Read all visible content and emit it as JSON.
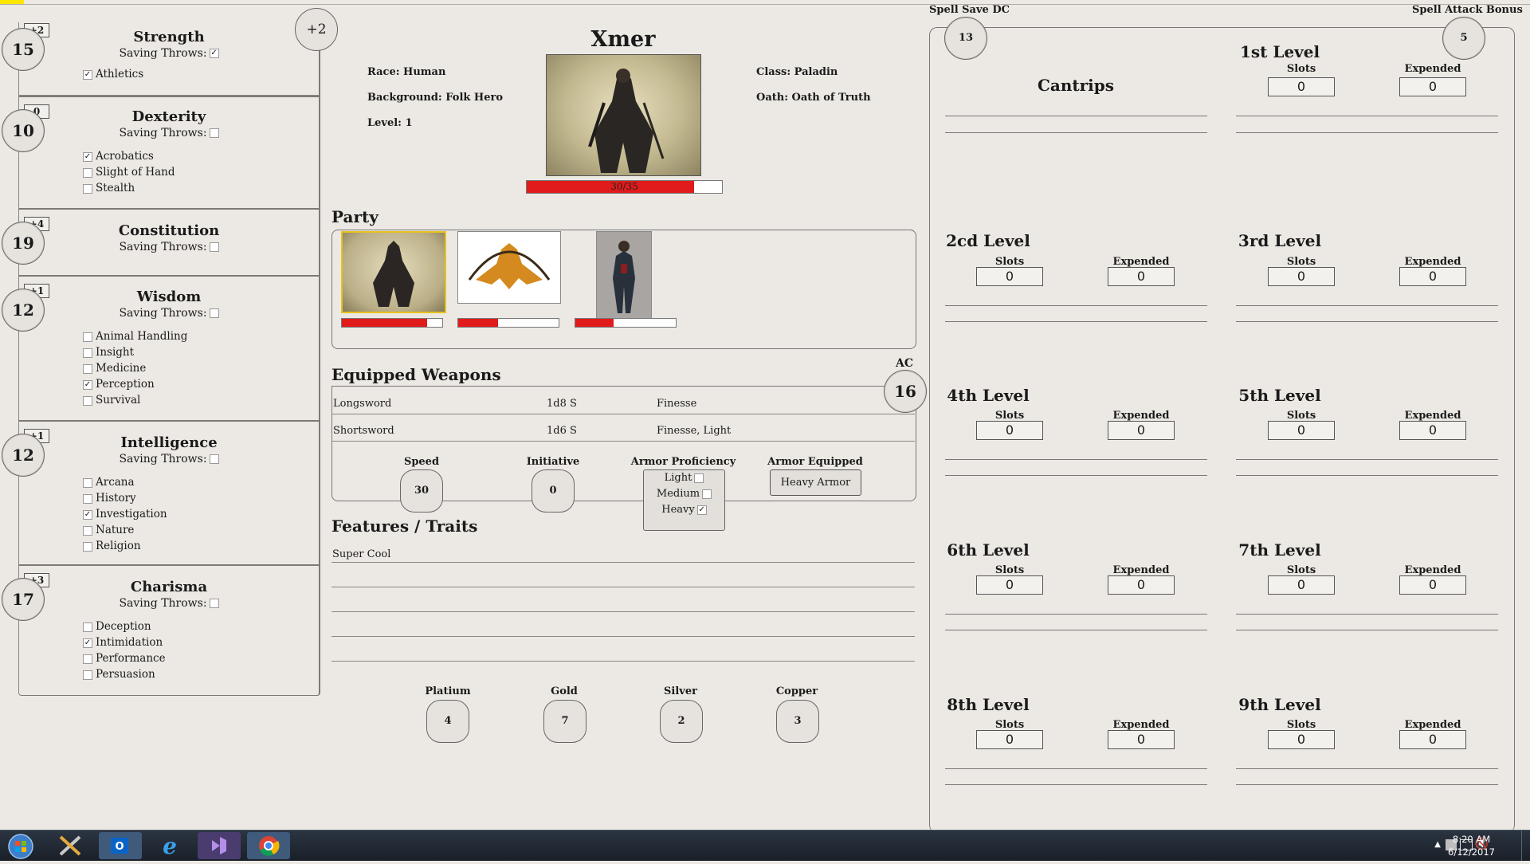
{
  "character": {
    "name": "Xmer",
    "race": "Race: Human",
    "background": "Background: Folk Hero",
    "level": "Level: 1",
    "class": "Class: Paladin",
    "oath": "Oath: Oath of Truth",
    "hp_text": "30/35",
    "hp_fraction": 0.857,
    "proficiency_bonus": "+2"
  },
  "abilities": {
    "strength": {
      "name": "Strength",
      "score": "15",
      "mod": "+2",
      "saving_label": "Saving Throws:",
      "saving": true,
      "skills": [
        {
          "label": "Athletics",
          "checked": true
        }
      ]
    },
    "dexterity": {
      "name": "Dexterity",
      "score": "10",
      "mod": "0",
      "saving_label": "Saving Throws:",
      "saving": false,
      "skills": [
        {
          "label": "Acrobatics",
          "checked": true
        },
        {
          "label": "Slight of Hand",
          "checked": false
        },
        {
          "label": "Stealth",
          "checked": false
        }
      ]
    },
    "constitution": {
      "name": "Constitution",
      "score": "19",
      "mod": "+4",
      "saving_label": "Saving Throws:",
      "saving": false,
      "skills": []
    },
    "wisdom": {
      "name": "Wisdom",
      "score": "12",
      "mod": "+1",
      "saving_label": "Saving Throws:",
      "saving": false,
      "skills": [
        {
          "label": "Animal Handling",
          "checked": false
        },
        {
          "label": "Insight",
          "checked": false
        },
        {
          "label": "Medicine",
          "checked": false
        },
        {
          "label": "Perception",
          "checked": true
        },
        {
          "label": "Survival",
          "checked": false
        }
      ]
    },
    "intelligence": {
      "name": "Intelligence",
      "score": "12",
      "mod": "+1",
      "saving_label": "Saving Throws:",
      "saving": false,
      "skills": [
        {
          "label": "Arcana",
          "checked": false
        },
        {
          "label": "History",
          "checked": false
        },
        {
          "label": "Investigation",
          "checked": true
        },
        {
          "label": "Nature",
          "checked": false
        },
        {
          "label": "Religion",
          "checked": false
        }
      ]
    },
    "charisma": {
      "name": "Charisma",
      "score": "17",
      "mod": "+3",
      "saving_label": "Saving Throws:",
      "saving": false,
      "skills": [
        {
          "label": "Deception",
          "checked": false
        },
        {
          "label": "Intimidation",
          "checked": true
        },
        {
          "label": "Performance",
          "checked": false
        },
        {
          "label": "Persuasion",
          "checked": false
        }
      ]
    }
  },
  "party": {
    "title": "Party",
    "members": [
      {
        "icon": "paladin-portrait",
        "hp_fraction": 0.85
      },
      {
        "icon": "archer-portrait",
        "hp_fraction": 0.4
      },
      {
        "icon": "rogue-portrait",
        "hp_fraction": 0.38
      }
    ]
  },
  "weapons": {
    "title": "Equipped Weapons",
    "rows": [
      {
        "name": "Longsword",
        "damage": "1d8 S",
        "properties": "Finesse"
      },
      {
        "name": "Shortsword",
        "damage": "1d6 S",
        "properties": "Finesse, Light"
      }
    ]
  },
  "ac": {
    "label": "AC",
    "value": "16"
  },
  "speed": {
    "label": "Speed",
    "value": "30"
  },
  "initiative": {
    "label": "Initiative",
    "value": "0"
  },
  "armor_proficiency": {
    "label": "Armor Proficiency",
    "light": "Light",
    "medium": "Medium",
    "heavy": "Heavy",
    "light_checked": false,
    "medium_checked": false,
    "heavy_checked": true
  },
  "armor_equipped": {
    "label": "Armor Equipped",
    "value": "Heavy Armor"
  },
  "features": {
    "title": "Features / Traits",
    "items": [
      "Super Cool"
    ]
  },
  "coins": {
    "platinum": {
      "label": "Platium",
      "value": "4"
    },
    "gold": {
      "label": "Gold",
      "value": "7"
    },
    "silver": {
      "label": "Silver",
      "value": "2"
    },
    "copper": {
      "label": "Copper",
      "value": "3"
    }
  },
  "spells": {
    "save_dc_label": "Spell Save DC",
    "save_dc": "13",
    "attack_label": "Spell Attack Bonus",
    "attack": "5",
    "cantrips": "Cantrips",
    "slots_label": "Slots",
    "expended_label": "Expended",
    "levels": [
      {
        "title": "1st Level",
        "slots": "0",
        "expended": "0"
      },
      {
        "title": "2cd Level",
        "slots": "0",
        "expended": "0"
      },
      {
        "title": "3rd Level",
        "slots": "0",
        "expended": "0"
      },
      {
        "title": "4th Level",
        "slots": "0",
        "expended": "0"
      },
      {
        "title": "5th Level",
        "slots": "0",
        "expended": "0"
      },
      {
        "title": "6th Level",
        "slots": "0",
        "expended": "0"
      },
      {
        "title": "7th Level",
        "slots": "0",
        "expended": "0"
      },
      {
        "title": "8th Level",
        "slots": "0",
        "expended": "0"
      },
      {
        "title": "9th Level",
        "slots": "0",
        "expended": "0"
      }
    ]
  },
  "taskbar": {
    "time": "8:20 AM",
    "date": "6/12/2017",
    "apps": [
      "start-icon",
      "tools-icon",
      "outlook-icon",
      "ie-icon",
      "visual-studio-icon",
      "chrome-icon"
    ]
  }
}
